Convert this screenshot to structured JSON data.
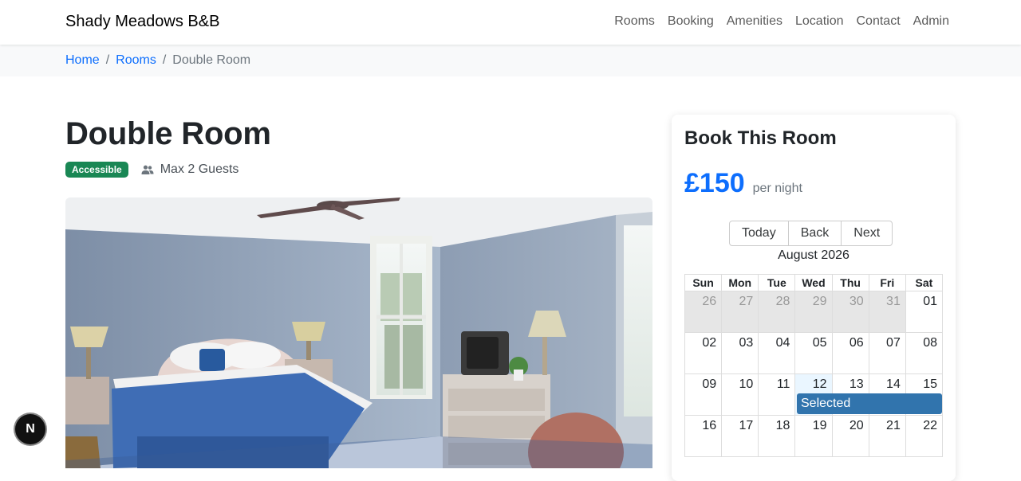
{
  "navbar": {
    "brand": "Shady Meadows B&B",
    "links": [
      "Rooms",
      "Booking",
      "Amenities",
      "Location",
      "Contact",
      "Admin"
    ]
  },
  "breadcrumb": {
    "home": "Home",
    "rooms": "Rooms",
    "current": "Double Room",
    "separator": "/"
  },
  "room": {
    "title": "Double Room",
    "badge": "Accessible",
    "guests": "Max 2 Guests"
  },
  "booking": {
    "title": "Book This Room",
    "price": "£150",
    "per_night": "per night",
    "buttons": {
      "today": "Today",
      "back": "Back",
      "next": "Next"
    },
    "month": "August 2026",
    "weekdays": [
      "Sun",
      "Mon",
      "Tue",
      "Wed",
      "Thu",
      "Fri",
      "Sat"
    ],
    "weeks": [
      [
        "26",
        "27",
        "28",
        "29",
        "30",
        "31",
        "01"
      ],
      [
        "02",
        "03",
        "04",
        "05",
        "06",
        "07",
        "08"
      ],
      [
        "09",
        "10",
        "11",
        "12",
        "13",
        "14",
        "15"
      ],
      [
        "16",
        "17",
        "18",
        "19",
        "20",
        "21",
        "22"
      ]
    ],
    "event_label": "Selected"
  },
  "floating_button": {
    "label": "N"
  },
  "colors": {
    "accent": "#0d6efd",
    "badge": "#198754",
    "event": "#3174ad",
    "off_day": "#e6e6e6",
    "today": "#eaf6ff"
  }
}
